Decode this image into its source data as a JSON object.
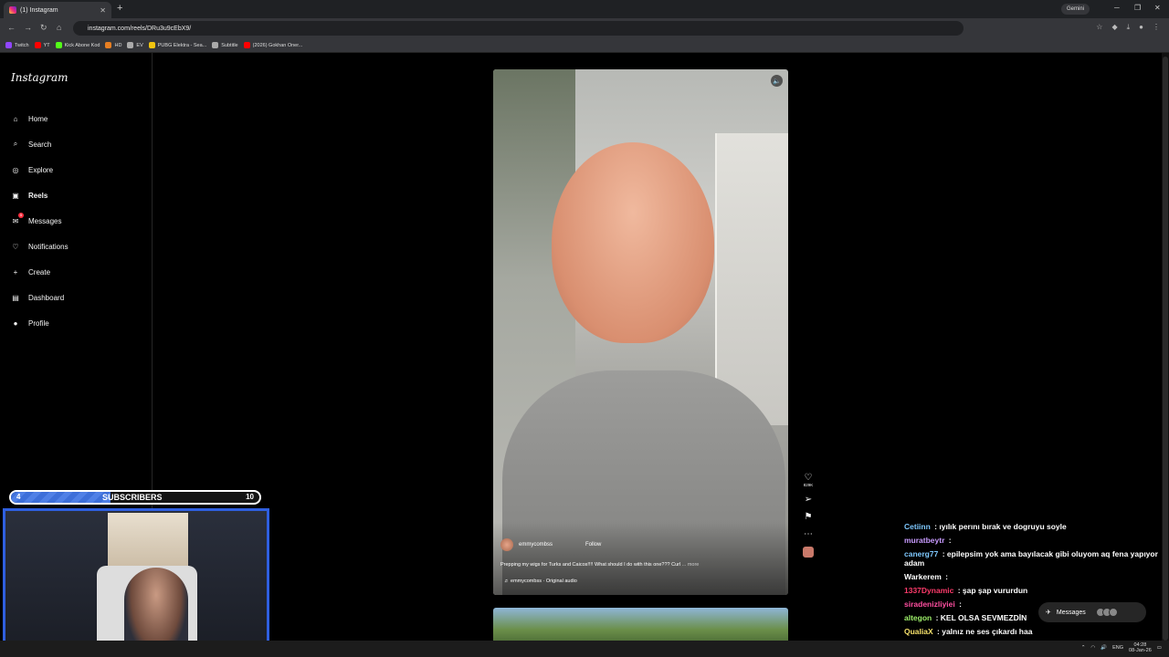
{
  "browser": {
    "tab_title": "(1) Instagram",
    "tab_close": "✕",
    "new_tab": "+",
    "url": "instagram.com/reels/DRu3u9cEbX9/",
    "gemini_label": "Gemini",
    "bookmarks": [
      {
        "label": "Twitch",
        "color": "#9146ff"
      },
      {
        "label": "YT",
        "color": "#ff0000"
      },
      {
        "label": "Kick Abone Kod",
        "color": "#53fc18"
      },
      {
        "label": "HD",
        "color": "#e67e22"
      },
      {
        "label": "EV",
        "color": "#aaaaaa"
      },
      {
        "label": "PUBG Elektra - Sea...",
        "color": "#f1c40f"
      },
      {
        "label": "Subtitle",
        "color": "#aaaaaa"
      },
      {
        "label": "(2026) Gokhan Oner...",
        "color": "#ff0000"
      }
    ]
  },
  "sidebar": {
    "logo": "Instagram",
    "items": [
      {
        "label": "Home",
        "icon": "home-icon"
      },
      {
        "label": "Search",
        "icon": "search-icon"
      },
      {
        "label": "Explore",
        "icon": "compass-icon"
      },
      {
        "label": "Reels",
        "icon": "reels-icon"
      },
      {
        "label": "Messages",
        "icon": "messenger-icon",
        "badge": "5"
      },
      {
        "label": "Notifications",
        "icon": "heart-icon"
      },
      {
        "label": "Create",
        "icon": "plus-icon"
      },
      {
        "label": "Dashboard",
        "icon": "dashboard-icon"
      },
      {
        "label": "Profile",
        "icon": "avatar-icon"
      }
    ]
  },
  "reel": {
    "username": "emmycombss",
    "follow_label": "Follow",
    "caption": "Prepping my wigs for Turks and Caicos!!!! What should I do with this one??? Curl",
    "more_label": "... more",
    "audio": "emmycombss · Original audio",
    "likes": "829K"
  },
  "overlay": {
    "subs_label": "SUBSCRIBERS",
    "subs_current": "4",
    "subs_goal": "10",
    "subs_progress": 0.4
  },
  "chat": [
    {
      "user": "Cetiinn",
      "color": "#7ec8ff",
      "text": "ıyılık perını bırak ve dogruyu soyle"
    },
    {
      "user": "muratbeytr",
      "color": "#c89bff",
      "text": ""
    },
    {
      "user": "canerg77",
      "color": "#7ec8ff",
      "text": "epilepsim yok ama bayılacak gibi oluyom aq fena yapıyor adam"
    },
    {
      "user": "Warkerem",
      "color": "#ffffff",
      "text": ""
    },
    {
      "user": "1337Dynamic",
      "color": "#ff3b6b",
      "text": "şap şap vururdun"
    },
    {
      "user": "siradenizliyiei",
      "color": "#ff4fa0",
      "text": ""
    },
    {
      "user": "altegon",
      "color": "#9ef06a",
      "text": "KEL OLSA SEVMEZDİN"
    },
    {
      "user": "QualiaX",
      "color": "#f7e26b",
      "text": "yalnız ne ses çıkardı haa"
    }
  ],
  "messages_pill": {
    "label": "Messages",
    "badge": "5"
  },
  "taskbar": {
    "lang": "ENG",
    "time": "04:28",
    "date": "08-Jan-26"
  }
}
